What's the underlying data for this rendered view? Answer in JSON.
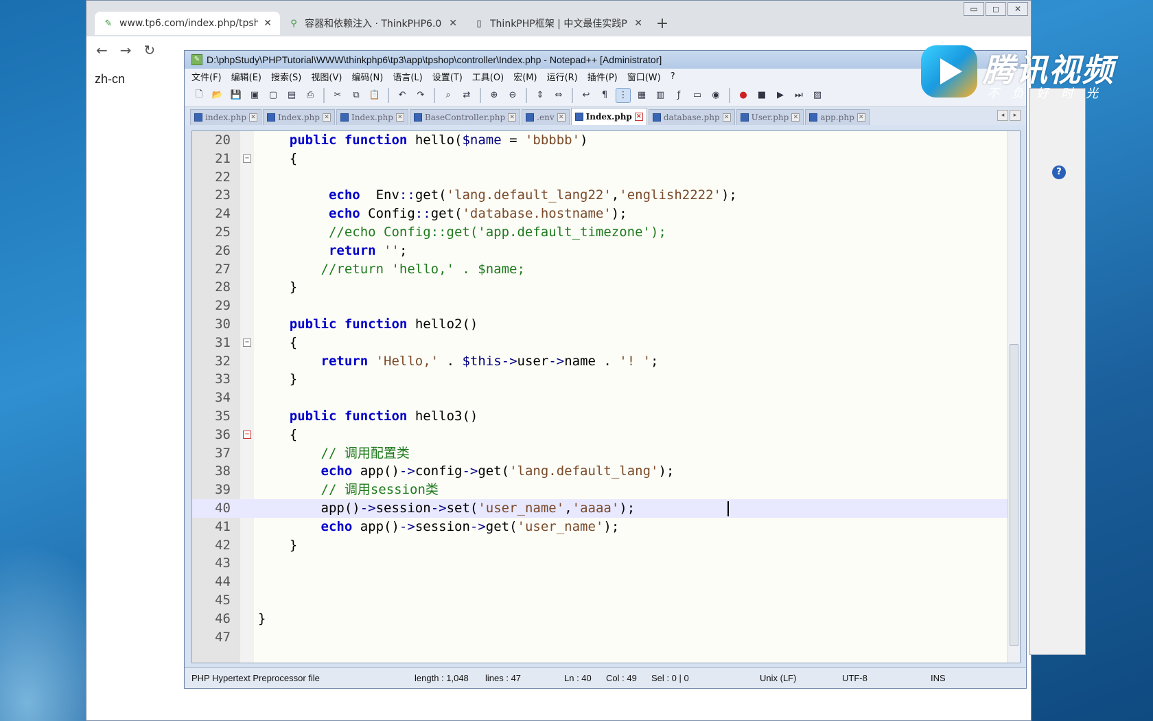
{
  "browser": {
    "tabs": [
      {
        "title": "www.tp6.com/index.php/tpsh",
        "icon": "thinkphp-icon",
        "active": true
      },
      {
        "title": "容器和依赖注入 · ThinkPHP6.0",
        "icon": "link-icon",
        "active": false
      },
      {
        "title": "ThinkPHP框架 | 中文最佳实践P",
        "icon": "page-icon",
        "active": false
      }
    ],
    "new_tab": "+",
    "close_glyph": "✕",
    "page_text": "zh-cn"
  },
  "npp": {
    "title": "D:\\phpStudy\\PHPTutorial\\WWW\\thinkphp6\\tp3\\app\\tpshop\\controller\\Index.php - Notepad++ [Administrator]",
    "menu": [
      "文件(F)",
      "编辑(E)",
      "搜索(S)",
      "视图(V)",
      "编码(N)",
      "语言(L)",
      "设置(T)",
      "工具(O)",
      "宏(M)",
      "运行(R)",
      "插件(P)",
      "窗口(W)",
      "?"
    ],
    "file_tabs": [
      {
        "label": "index.php",
        "active": false
      },
      {
        "label": "Index.php",
        "active": false
      },
      {
        "label": "Index.php",
        "active": false
      },
      {
        "label": "BaseController.php",
        "active": false
      },
      {
        "label": ".env",
        "active": false
      },
      {
        "label": "Index.php",
        "active": true
      },
      {
        "label": "database.php",
        "active": false
      },
      {
        "label": "User.php",
        "active": false
      },
      {
        "label": "app.php",
        "active": false
      }
    ],
    "lines": [
      {
        "n": "20",
        "text": "    public function hello($name = 'bbbbb')",
        "fold": ""
      },
      {
        "n": "21",
        "text": "    {",
        "fold": "⊟"
      },
      {
        "n": "22",
        "text": "",
        "fold": ""
      },
      {
        "n": "23",
        "text": "         echo  Env::get('lang.default_lang22','english2222');",
        "fold": ""
      },
      {
        "n": "24",
        "text": "         echo Config::get('database.hostname');",
        "fold": ""
      },
      {
        "n": "25",
        "text": "         //echo Config::get('app.default_timezone');",
        "fold": ""
      },
      {
        "n": "26",
        "text": "         return '';",
        "fold": ""
      },
      {
        "n": "27",
        "text": "        //return 'hello,' . $name;",
        "fold": ""
      },
      {
        "n": "28",
        "text": "    }",
        "fold": ""
      },
      {
        "n": "29",
        "text": "",
        "fold": ""
      },
      {
        "n": "30",
        "text": "    public function hello2()",
        "fold": ""
      },
      {
        "n": "31",
        "text": "    {",
        "fold": "⊟"
      },
      {
        "n": "32",
        "text": "        return 'Hello,' . $this->user->name . '! ';",
        "fold": ""
      },
      {
        "n": "33",
        "text": "    }",
        "fold": ""
      },
      {
        "n": "34",
        "text": "",
        "fold": ""
      },
      {
        "n": "35",
        "text": "    public function hello3()",
        "fold": ""
      },
      {
        "n": "36",
        "text": "    {",
        "fold": "⊟"
      },
      {
        "n": "37",
        "text": "        // 调用配置类",
        "fold": ""
      },
      {
        "n": "38",
        "text": "        echo app()->config->get('lang.default_lang');",
        "fold": ""
      },
      {
        "n": "39",
        "text": "        // 调用session类",
        "fold": ""
      },
      {
        "n": "40",
        "text": "        app()->session->set('user_name','aaaa');",
        "fold": "",
        "current": true
      },
      {
        "n": "41",
        "text": "        echo app()->session->get('user_name');",
        "fold": ""
      },
      {
        "n": "42",
        "text": "    }",
        "fold": ""
      },
      {
        "n": "43",
        "text": "",
        "fold": ""
      },
      {
        "n": "44",
        "text": "",
        "fold": ""
      },
      {
        "n": "45",
        "text": "",
        "fold": ""
      },
      {
        "n": "46",
        "text": "}",
        "fold": ""
      },
      {
        "n": "47",
        "text": "",
        "fold": ""
      }
    ],
    "status": {
      "type": "PHP Hypertext Preprocessor file",
      "length": "length : 1,048",
      "lines": "lines : 47",
      "ln": "Ln : 40",
      "col": "Col : 49",
      "sel": "Sel : 0 | 0",
      "eol": "Unix (LF)",
      "encoding": "UTF-8",
      "mode": "INS"
    }
  },
  "watermark": {
    "brand": "腾讯视频",
    "slogan": "不负好时光"
  }
}
